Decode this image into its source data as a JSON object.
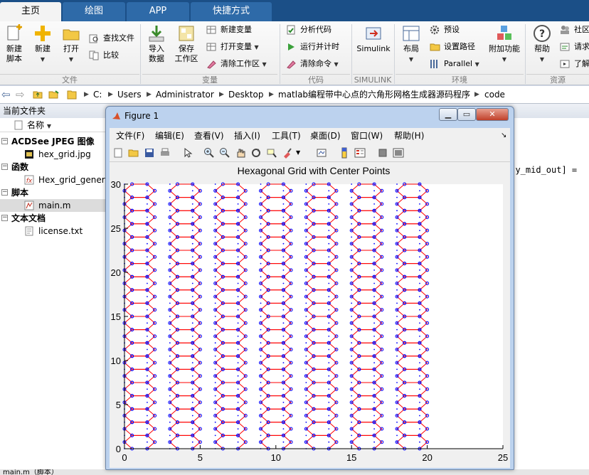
{
  "tabs": [
    "主页",
    "绘图",
    "APP",
    "快捷方式"
  ],
  "ribbon": {
    "file": {
      "new_script": "新建\n脚本",
      "new": "新建",
      "open": "打开",
      "find_files": "查找文件",
      "compare": "比较",
      "group": "文件"
    },
    "variable": {
      "import": "导入\n数据",
      "save_workspace": "保存\n工作区",
      "new_variable": "新建变量",
      "open_variable": "打开变量",
      "clear_workspace": "清除工作区",
      "group": "变量"
    },
    "code": {
      "analyze": "分析代码",
      "run_time": "运行并计时",
      "clear_commands": "清除命令",
      "group": "代码"
    },
    "simulink": {
      "label": "Simulink",
      "group": "SIMULINK"
    },
    "environment": {
      "layout": "布局",
      "preferences": "预设",
      "set_path": "设置路径",
      "parallel": "Parallel",
      "addons": "附加功能",
      "group": "环境"
    },
    "resources": {
      "help": "帮助",
      "community": "社区",
      "request": "请求",
      "learn": "了解",
      "group": "资源"
    }
  },
  "address": [
    "C:",
    "Users",
    "Administrator",
    "Desktop",
    "matlab编程带中心点的六角形网格生成器源码程序",
    "code"
  ],
  "panel": {
    "title": "当前文件夹",
    "col_name": "名称",
    "groups": [
      {
        "label": "ACDSee JPEG 图像",
        "files": [
          "hex_grid.jpg"
        ]
      },
      {
        "label": "函数",
        "files": [
          "Hex_grid_genera"
        ]
      },
      {
        "label": "脚本",
        "files": [
          "main.m"
        ]
      },
      {
        "label": "文本文档",
        "files": [
          "license.txt"
        ]
      }
    ],
    "status": "main.m（脚本）"
  },
  "editor": {
    "code_fragment": "t,y_mid_out] ="
  },
  "figure": {
    "title": "Figure 1",
    "menu": [
      "文件(F)",
      "编辑(E)",
      "查看(V)",
      "插入(I)",
      "工具(T)",
      "桌面(D)",
      "窗口(W)",
      "帮助(H)"
    ]
  },
  "chart_data": {
    "type": "line",
    "title": "Hexagonal Grid with Center Points",
    "xlabel": "",
    "ylabel": "",
    "xlim": [
      0,
      25
    ],
    "ylim": [
      0,
      30
    ],
    "xticks": [
      0,
      5,
      10,
      15,
      20,
      25
    ],
    "yticks": [
      0,
      5,
      10,
      15,
      20,
      25,
      30
    ],
    "grid": false,
    "series": [
      {
        "kind": "hexagon-edges",
        "color": "#ff0000",
        "hex_size": 1,
        "columns_x": [
          1,
          4,
          7,
          10,
          13,
          16,
          19
        ],
        "rows": 20,
        "row_spacing": 1.5,
        "y_start": 0.75
      },
      {
        "kind": "vertices",
        "color": "#0000ff",
        "marker": "circle"
      },
      {
        "kind": "center-points",
        "color": "#0000ff",
        "marker": "dot",
        "x_range": [
          0,
          20.5
        ],
        "x_step": 1.5,
        "y_range": [
          0,
          30
        ],
        "y_step": 0.75
      }
    ]
  },
  "colors": {
    "tab_active": "#f3f3f3",
    "tabbar": "#1b4f87",
    "hex_edge": "#ff0000",
    "vertex": "#0000ff"
  }
}
